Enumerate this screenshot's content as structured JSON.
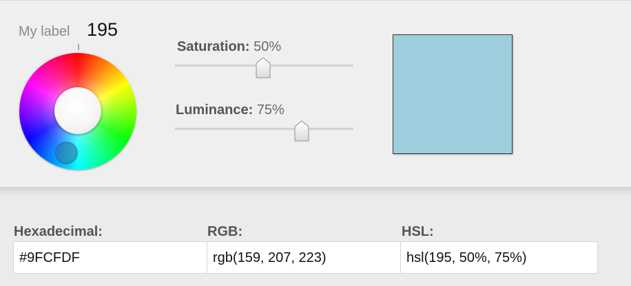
{
  "wheel": {
    "label": "My label",
    "value": "195",
    "handle_color": "#3a6e96"
  },
  "saturation": {
    "label": "Saturation:",
    "value_text": "50%",
    "value": 0.5
  },
  "luminance": {
    "label": "Luminance:",
    "value_text": "75%",
    "value": 0.75
  },
  "preview": {
    "color": "#9FCFDF"
  },
  "values": {
    "hex_label": "Hexadecimal:",
    "hex_value": "#9FCFDF",
    "rgb_label": "RGB:",
    "rgb_value": "rgb(159, 207, 223)",
    "hsl_label": "HSL:",
    "hsl_value": "hsl(195, 50%, 75%)"
  }
}
